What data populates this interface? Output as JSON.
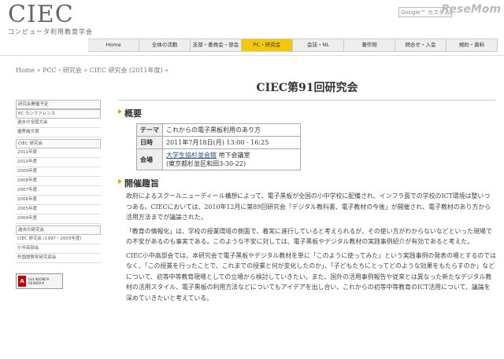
{
  "logo": {
    "main": "CIEC",
    "sub": "コンピュータ利用教育学会"
  },
  "search": {
    "placeholder": "Google™ カスタム検索"
  },
  "watermark": "ReseMom",
  "nav": [
    "Home",
    "全体の活動",
    "支部・委員会・部会",
    "PC・研究会",
    "会誌・NL",
    "著作物",
    "問合せ・入会",
    "規約・資料"
  ],
  "nav_active_index": 3,
  "breadcrumb": "Home » PCC・研究会 » CIEC 研究会 (2011年度) »",
  "sidebar": [
    "研究会開催予定",
    "PC カンファレンス",
    "過去の全国大会",
    "優秀論文賞",
    "CIEC 研究会",
    "2011年度",
    "2010年度",
    "2009年度",
    "2008年度",
    "2007年度",
    "2006年度",
    "2005年度",
    "2004年度",
    "過去の研究会",
    "CIEC 研究会 (1997・2003年度)",
    "小中高部会",
    "外国語教育研究部会"
  ],
  "adobe": {
    "icon": "A",
    "text": "Get ADOBE® READER®"
  },
  "page_title": "CIEC第91回研究会",
  "overview": {
    "heading": "概要",
    "rows": [
      {
        "label": "テーマ",
        "value": "これからの電子黒板利用のあり方"
      },
      {
        "label": "日時",
        "value": "2011年7月18日(月) 13:00 - 16:25"
      },
      {
        "label": "会場",
        "link": "大学生協杉並会館",
        "value_after": " 地下会議室",
        "value2": "(東京都杉並区和田3-30-22)"
      }
    ]
  },
  "purpose": {
    "heading": "開催趣旨",
    "paragraphs": [
      "政府によるスクールニューディール構想によって、電子黒板が全国の小中学校に配備され、インフラ面での学校のICT環境は整いつつある。CIECにおいては、2010年12月に第89回研究会「デジタル教科書、電子教材の今後」が開催され、電子教材のあり方から活用方法までが議論された。",
      "「教育の情報化」は、学校の授業環境の側面で、着実に進行していると考えられるが、その使い方がわからないなどといった現場での不安があるのも事実である。このような不安に対しては、電子黒板やデジタル教材の実践事例紹介が有効であると考えた。",
      "CIEC小中高部会では、本研究会で電子黒板やデジタル教材を単に「このように使ってみた」という実践事例の発表の場とするのではなく、「この授業を行ったことで、これまでの授業と何が変化したのか」、「子どもたちにとってどのような効果をもたらすのか」などについて、初等中等教育現場としての立場から検討していきたい。また、国外の活用事例報告や従来とは異なった新たなデジタル教材の活用スタイル、電子黒板の利用方法などについてもアイデアを出し合い、これからの初等中等教育のICT活用について、議論を深めていきたいと考えている。"
    ]
  }
}
